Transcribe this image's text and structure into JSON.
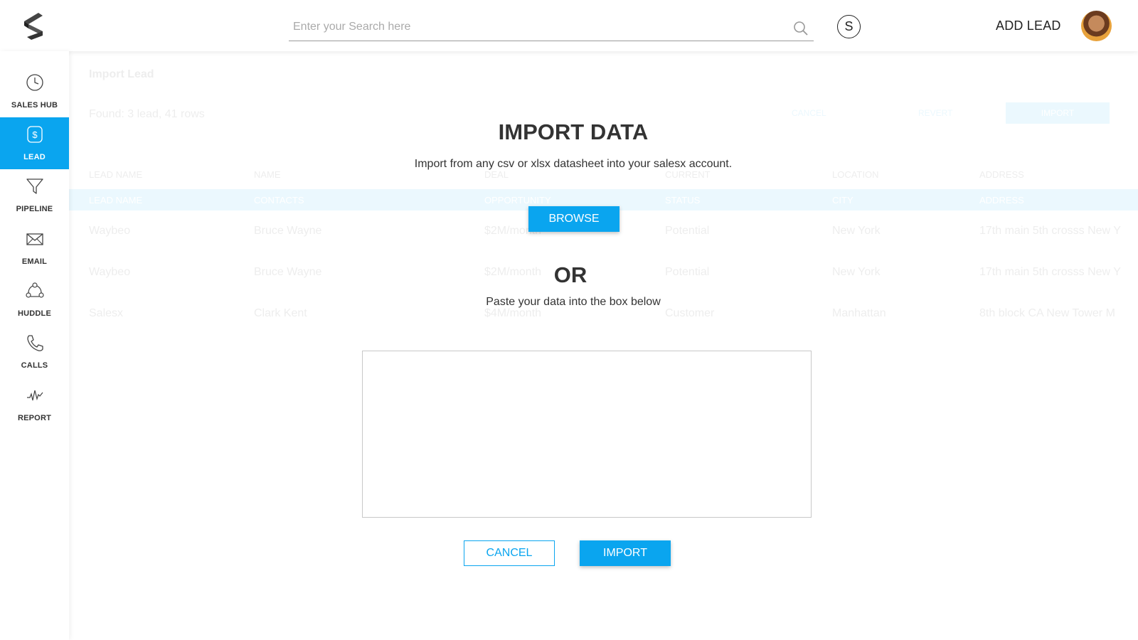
{
  "header": {
    "search_placeholder": "Enter your Search here",
    "user_initial": "S",
    "add_lead_label": "ADD LEAD"
  },
  "sidebar": {
    "items": [
      {
        "label": "SALES HUB",
        "icon": "clock-icon",
        "active": false
      },
      {
        "label": "LEAD",
        "icon": "dollar-icon",
        "active": true
      },
      {
        "label": "PIPELINE",
        "icon": "funnel-icon",
        "active": false
      },
      {
        "label": "EMAIL",
        "icon": "envelope-icon",
        "active": false
      },
      {
        "label": "HUDDLE",
        "icon": "huddle-icon",
        "active": false
      },
      {
        "label": "CALLS",
        "icon": "phone-icon",
        "active": false
      },
      {
        "label": "REPORT",
        "icon": "pulse-icon",
        "active": false
      }
    ]
  },
  "background": {
    "title": "Import Lead",
    "found_text": "Found: 3 lead, 41 rows",
    "cancel_label": "CANCEL",
    "revert_label": "REVERT",
    "import_label": "IMPORT",
    "columns": [
      "LEAD NAME",
      "NAME",
      "DEAL",
      "CURRENT",
      "LOCATION",
      "ADDRESS"
    ],
    "mapping_row": [
      "LEAD NAME",
      "CONTACTS",
      "OPPORTUNITY",
      "STATUS",
      "CITY",
      "ADDRESS"
    ],
    "rows": [
      [
        "Waybeo",
        "Bruce Wayne",
        "$2M/month",
        "Potential",
        "New York",
        "17th main 5th crosss New Y"
      ],
      [
        "Waybeo",
        "Bruce Wayne",
        "$2M/month",
        "Potential",
        "New York",
        "17th main 5th crosss New Y"
      ],
      [
        "Salesx",
        "Clark Kent",
        "$4M/month",
        "Customer",
        "Manhattan",
        "8th block CA New Tower M"
      ]
    ]
  },
  "modal": {
    "title": "IMPORT DATA",
    "subtitle": "Import from any csv or xlsx datasheet into your salesx account.",
    "browse_label": "BROWSE",
    "or_text": "OR",
    "paste_text": "Paste your data into the box below",
    "paste_value": "",
    "cancel_label": "CANCEL",
    "import_label": "IMPORT"
  },
  "colors": {
    "accent": "#0aa5ef",
    "text": "#333333"
  }
}
